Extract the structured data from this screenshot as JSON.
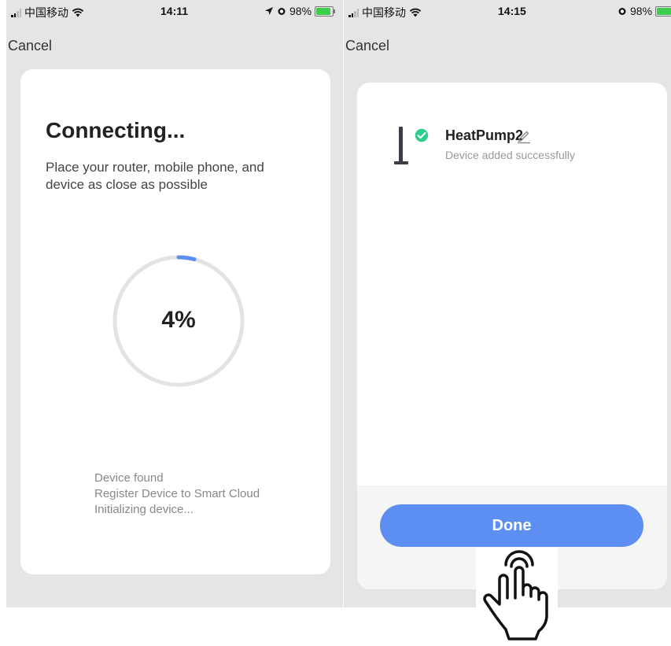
{
  "left_screen": {
    "status": {
      "carrier": "中国移动",
      "time": "14:11",
      "battery": "98%"
    },
    "cancel_label": "Cancel",
    "title": "Connecting...",
    "description": "Place your router, mobile phone, and device as close as possible",
    "progress": {
      "percent": 4,
      "label": "4%"
    },
    "steps": [
      "Device found",
      "Register Device to Smart Cloud",
      "Initializing device..."
    ]
  },
  "right_screen": {
    "status": {
      "carrier": "中国移动",
      "time": "14:15",
      "battery": "98%"
    },
    "cancel_label": "Cancel",
    "device": {
      "name": "HeatPump2",
      "status": "Device added successfully"
    },
    "done_label": "Done"
  },
  "colors": {
    "accent": "#5d8ff2",
    "success": "#2ecc8f",
    "background": "#e5e5e5",
    "card": "#ffffff"
  },
  "icons": [
    "signal-icon",
    "wifi-icon",
    "location-arrow-icon",
    "alarm-icon",
    "battery-icon",
    "device-thumbnail-icon",
    "success-check-icon",
    "edit-pencil-icon",
    "hand-pointer-icon"
  ]
}
